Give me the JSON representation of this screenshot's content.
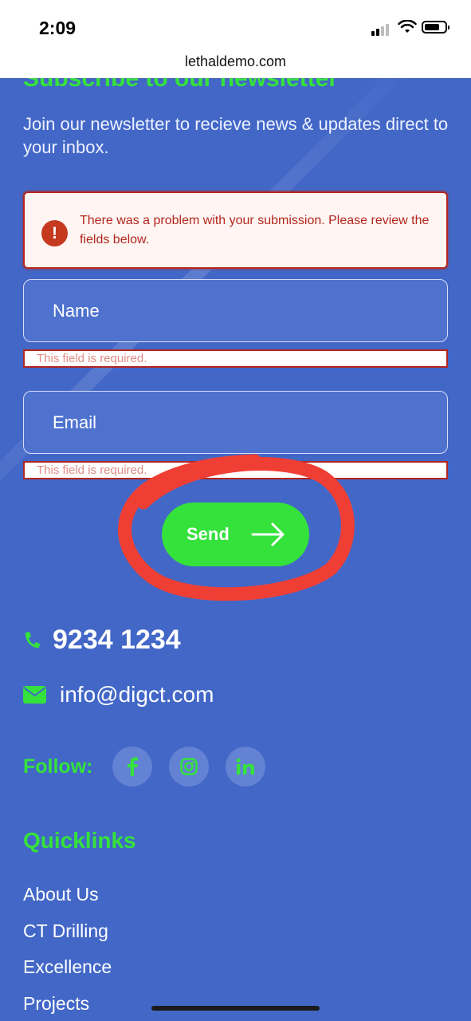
{
  "status": {
    "time": "2:09"
  },
  "browser": {
    "url": "lethaldemo.com"
  },
  "newsletter": {
    "heading_partial": "Subscribe to our newsletter",
    "intro": "Join our newsletter to recieve news & updates direct to your inbox.",
    "alert": "There was a problem with your submission. Please review the fields below.",
    "fields": [
      {
        "label": "Name",
        "error": "This field is required."
      },
      {
        "label": "Email",
        "error": "This field is required."
      }
    ],
    "send_label": "Send"
  },
  "contact": {
    "phone": "9234 1234",
    "email": "info@digct.com"
  },
  "follow": {
    "label": "Follow:",
    "icons": [
      "facebook-icon",
      "instagram-icon",
      "linkedin-icon"
    ]
  },
  "quicklinks": {
    "title": "Quicklinks",
    "items": [
      {
        "label": "About Us"
      },
      {
        "label": "CT Drilling"
      },
      {
        "label": "Excellence"
      },
      {
        "label": "Projects"
      }
    ]
  },
  "colors": {
    "background": "#4267c7",
    "accent_green": "#35e23c",
    "error_red": "#b3261e",
    "annotation_red": "#ef3f35"
  }
}
